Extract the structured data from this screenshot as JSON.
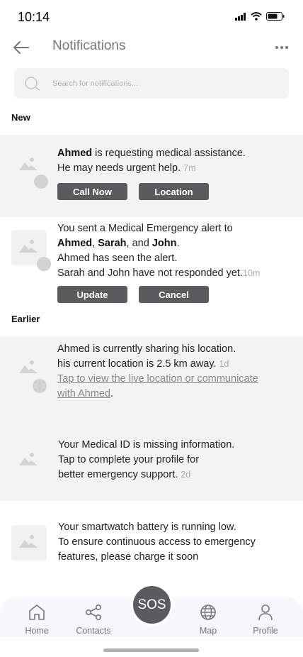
{
  "status": {
    "time": "10:14"
  },
  "header": {
    "title": "Notifications"
  },
  "search": {
    "placeholder": "Search for notifications..."
  },
  "sections": {
    "new": "New",
    "earlier": "Earlier"
  },
  "notifications": [
    {
      "name": "Ahmed",
      "text_1": " is requesting medical assistance.",
      "text_2": " He may needs urgent help.",
      "time": "7m",
      "buttons": [
        "Call Now",
        "Location"
      ]
    },
    {
      "line_1": "You sent a Medical Emergency alert to",
      "names": [
        "Ahmed",
        "Sarah",
        "John"
      ],
      "sep_1": ", ",
      "sep_2": ", and ",
      "end": ".",
      "line_3": "Ahmed has seen the alert.",
      "line_4": "Sarah and John have not responded yet.",
      "time": "10m",
      "buttons": [
        "Update",
        "Cancel"
      ]
    },
    {
      "line_1": "Ahmed is currently sharing his location.",
      "line_2": "his current location is 2.5 km away.",
      "time": "1d",
      "link_1": " Tap to view the live location or communicate",
      "link_2": " with Ahmed",
      "link_end": "."
    },
    {
      "line_1": "Your Medical ID is missing information.",
      "line_2": "Tap to complete your profile for",
      "line_3": " better emergency support.",
      "time": "2d"
    },
    {
      "line_1": "Your smartwatch battery is running low.",
      "line_2": "To ensure continuous access to emergency",
      "line_3": " features, please charge it soon"
    }
  ],
  "tabbar": {
    "items": [
      "Home",
      "Contacts",
      "Map",
      "Profile"
    ],
    "sos": "SOS"
  },
  "icons": [
    "back-arrow-icon",
    "more-icon",
    "search-icon",
    "image-placeholder-icon",
    "home-icon",
    "contacts-share-icon",
    "globe-icon",
    "profile-icon",
    "signal-icon",
    "wifi-icon",
    "battery-icon"
  ]
}
